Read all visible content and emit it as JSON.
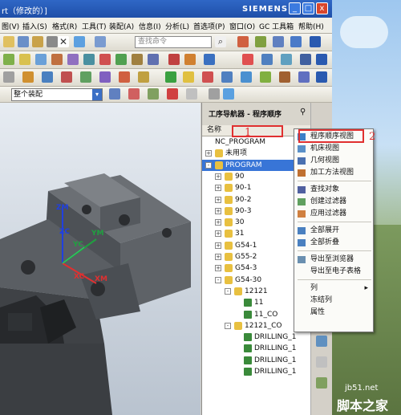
{
  "window": {
    "title": "rt（修改的）]",
    "brand": "SIEMENS",
    "controls": [
      "_",
      "□",
      "x"
    ]
  },
  "menubar": [
    "图(V)",
    "插入(S)",
    "格式(R)",
    "工具(T)",
    "装配(A)",
    "信息(I)",
    "分析(L)",
    "首选项(P)",
    "窗口(O)",
    "GC 工具箱",
    "帮助(H)"
  ],
  "toolbar": {
    "search_placeholder": "查找命令",
    "assembly_filter": "整个装配"
  },
  "viewport": {
    "axes": [
      "ZM",
      "ZC",
      "YM",
      "YC",
      "XC",
      "XM"
    ]
  },
  "navigator": {
    "title": "工序导航器 - 程序顺序",
    "column": "名称",
    "rows": [
      {
        "label": "NC_PROGRAM",
        "expander": "",
        "indent": 0,
        "icon": "none",
        "selected": false
      },
      {
        "label": "未用项",
        "expander": "+",
        "indent": 0,
        "icon": "folder",
        "selected": false
      },
      {
        "label": "PROGRAM",
        "expander": "-",
        "indent": 0,
        "icon": "folder-group",
        "selected": true
      },
      {
        "label": "90",
        "expander": "+",
        "indent": 1,
        "icon": "group",
        "selected": false
      },
      {
        "label": "90-1",
        "expander": "+",
        "indent": 1,
        "icon": "group",
        "selected": false
      },
      {
        "label": "90-2",
        "expander": "+",
        "indent": 1,
        "icon": "group",
        "selected": false
      },
      {
        "label": "90-3",
        "expander": "+",
        "indent": 1,
        "icon": "group",
        "selected": false
      },
      {
        "label": "30",
        "expander": "+",
        "indent": 1,
        "icon": "group",
        "selected": false
      },
      {
        "label": "31",
        "expander": "+",
        "indent": 1,
        "icon": "group",
        "selected": false
      },
      {
        "label": "G54-1",
        "expander": "+",
        "indent": 1,
        "icon": "group",
        "selected": false
      },
      {
        "label": "G55-2",
        "expander": "+",
        "indent": 1,
        "icon": "group",
        "selected": false
      },
      {
        "label": "G54-3",
        "expander": "+",
        "indent": 1,
        "icon": "group",
        "selected": false
      },
      {
        "label": "G54-30",
        "expander": "-",
        "indent": 1,
        "icon": "group",
        "selected": false
      },
      {
        "label": "12121",
        "expander": "-",
        "indent": 2,
        "icon": "group",
        "selected": false
      },
      {
        "label": "11",
        "expander": "",
        "indent": 3,
        "icon": "op",
        "selected": false
      },
      {
        "label": "11_CO",
        "expander": "",
        "indent": 3,
        "icon": "op",
        "selected": false
      },
      {
        "label": "12121_CO",
        "expander": "-",
        "indent": 2,
        "icon": "group",
        "selected": false
      },
      {
        "label": "DRILLING_1",
        "expander": "",
        "indent": 3,
        "icon": "op",
        "selected": false
      },
      {
        "label": "DRILLING_1",
        "expander": "",
        "indent": 3,
        "icon": "op",
        "selected": false
      },
      {
        "label": "DRILLING_1",
        "expander": "",
        "indent": 3,
        "icon": "op",
        "selected": false
      },
      {
        "label": "DRILLING_1",
        "expander": "",
        "indent": 3,
        "icon": "op",
        "selected": false
      }
    ]
  },
  "context_menu": {
    "items": [
      {
        "label": "程序顺序视图",
        "icon": "program-view-icon",
        "highlight": true
      },
      {
        "label": "机床视图",
        "icon": "machine-view-icon"
      },
      {
        "label": "几何视图",
        "icon": "geometry-view-icon"
      },
      {
        "label": "加工方法视图",
        "icon": "method-view-icon"
      },
      {
        "label": "查找对象",
        "icon": "find-icon"
      },
      {
        "label": "创建过滤器",
        "icon": "filter-create-icon"
      },
      {
        "label": "应用过滤器",
        "icon": "filter-apply-icon"
      },
      {
        "label": "全部展开",
        "icon": "expand-all-icon"
      },
      {
        "label": "全部折叠",
        "icon": "collapse-all-icon"
      },
      {
        "label": "导出至浏览器",
        "icon": "export-browser-icon"
      },
      {
        "label": "导出至电子表格",
        "icon": ""
      },
      {
        "label": "列",
        "icon": "",
        "submenu": true
      },
      {
        "label": "冻结列",
        "icon": ""
      },
      {
        "label": "属性",
        "icon": ""
      }
    ]
  },
  "annotations": {
    "label1": "1",
    "label2": "2"
  },
  "watermark": {
    "url": "jb51.net",
    "name": "脚本之家"
  },
  "colors": {
    "titlebar": "#2f67c6",
    "selection": "#3875d7",
    "annotation_red": "#e03030"
  }
}
